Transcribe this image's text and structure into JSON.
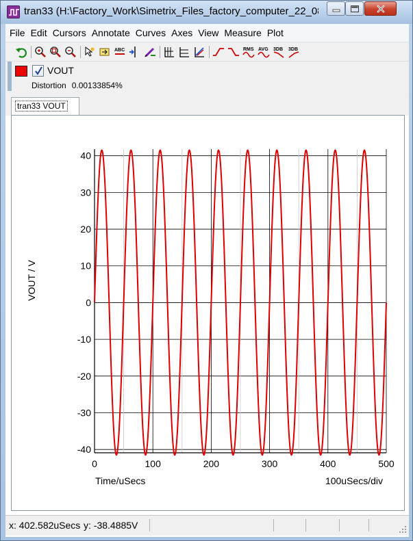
{
  "window": {
    "title": "tran33 (H:\\Factory_Work\\Simetrix_Files_factory_computer_22_08_..."
  },
  "menu": [
    "File",
    "Edit",
    "Cursors",
    "Annotate",
    "Curves",
    "Axes",
    "View",
    "Measure",
    "Plot"
  ],
  "toolbar": {
    "icons": [
      "undo-icon",
      "zoom-in-icon",
      "zoom-fit-icon",
      "zoom-out-icon",
      "cursor-icon",
      "pan-icon",
      "annotate-icon",
      "cursor-vertical-icon",
      "cursor-pen-icon",
      "grid-x-icon",
      "grid-y-icon",
      "axis-icon",
      "rise-time-icon",
      "fall-time-icon",
      "rms-icon",
      "avg-icon",
      "bandwidth-3db-icon",
      "highpass-3db-icon"
    ],
    "rms_label": "RMS",
    "avg_label": "AVG",
    "db_label": "3DB",
    "db_label2": "3DB"
  },
  "legend": {
    "curve_color": "#ee0000",
    "curve_name": "VOUT",
    "checked": true,
    "measure_label": "Distortion",
    "measure_value": "0.00133854%"
  },
  "tab": {
    "label": "tran33 VOUT"
  },
  "chart_data": {
    "type": "line",
    "xlabel": "Time/uSecs",
    "ylabel": "VOUT / V",
    "xdiv_label": "100uSecs/div",
    "xlim": [
      0,
      500
    ],
    "ylim": [
      -40,
      40
    ],
    "xticks": [
      0,
      100,
      200,
      300,
      400,
      500
    ],
    "yticks": [
      -40,
      -30,
      -20,
      -10,
      0,
      10,
      20,
      30,
      40
    ],
    "grid": true,
    "series": [
      {
        "color": "#dd0000",
        "function": "sine",
        "amplitude": 41.5,
        "frequency_khz": 20,
        "phase_deg": 0
      }
    ]
  },
  "status": {
    "x_readout": "x: 402.582uSecs",
    "y_readout": "y: -38.4885V"
  }
}
